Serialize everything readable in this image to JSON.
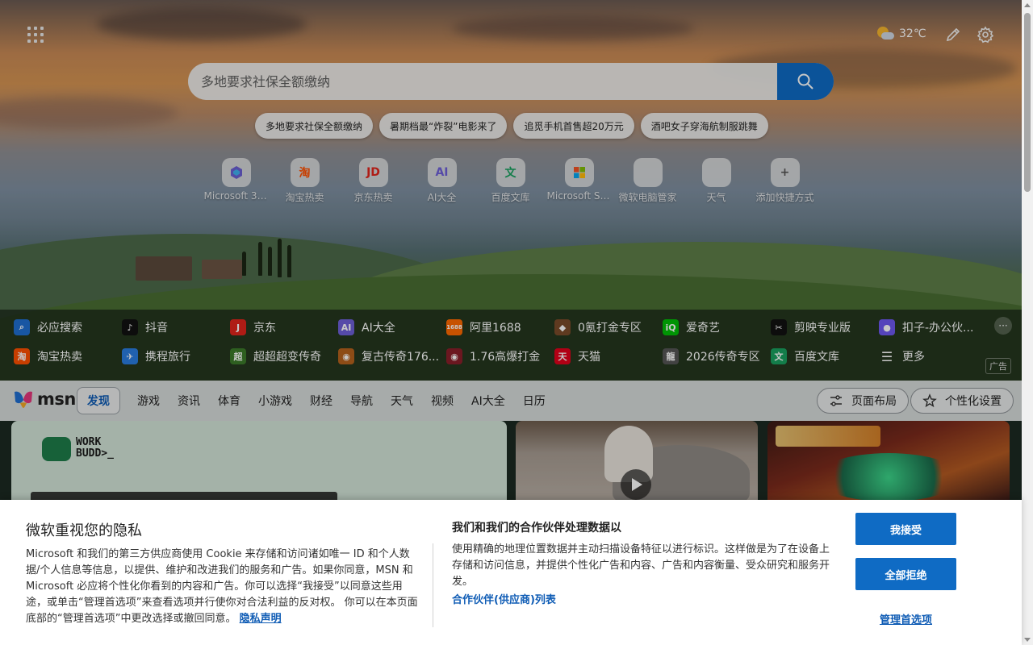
{
  "header": {
    "weather": {
      "temp": "32℃",
      "icon": "partly-cloudy-icon"
    },
    "icons": [
      "apps-grid-icon",
      "pencil-icon",
      "gear-icon"
    ]
  },
  "search": {
    "placeholder": "多地要求社保全额缴纳",
    "button_icon": "search-icon"
  },
  "trending": [
    "多地要求社保全额缴纳",
    "暑期档最“炸裂”电影来了",
    "追觅手机首售超20万元",
    "酒吧女子穿海航制服跳舞"
  ],
  "shortcuts": [
    {
      "label": "Microsoft 365",
      "icon": "m365-icon",
      "glyph": "",
      "color": "#6b5fd3"
    },
    {
      "label": "淘宝热卖",
      "icon": "taobao-icon",
      "glyph": "淘",
      "color": "#ff5000"
    },
    {
      "label": "京东热卖",
      "icon": "jd-icon",
      "glyph": "JD",
      "color": "#e1251b"
    },
    {
      "label": "AI大全",
      "icon": "ai-icon",
      "glyph": "AI",
      "color": "#6d5fd8"
    },
    {
      "label": "百度文库",
      "icon": "baidu-wenku-icon",
      "glyph": "文",
      "color": "#19a15f"
    },
    {
      "label": "Microsoft St...",
      "icon": "microsoft-store-icon",
      "glyph": "",
      "color": "#999"
    },
    {
      "label": "微软电脑管家",
      "icon": "pc-manager-icon",
      "glyph": "",
      "color": "#999"
    },
    {
      "label": "天气",
      "icon": "weather-icon",
      "glyph": "",
      "color": "#999"
    },
    {
      "label": "添加快捷方式",
      "icon": "plus-icon",
      "glyph": "+",
      "color": "#555"
    }
  ],
  "quick_links": [
    {
      "label": "必应搜索",
      "icon": "bing-search-icon",
      "glyph": "⌕",
      "color": "#1f6fd1"
    },
    {
      "label": "抖音",
      "icon": "douyin-icon",
      "glyph": "♪",
      "color": "#111"
    },
    {
      "label": "京东",
      "icon": "jd-icon",
      "glyph": "J",
      "color": "#e1251b"
    },
    {
      "label": "AI大全",
      "icon": "ai-icon",
      "glyph": "AI",
      "color": "#6d5fd8"
    },
    {
      "label": "阿里1688",
      "icon": "ali1688-icon",
      "glyph": "1688",
      "color": "#ff6a00"
    },
    {
      "label": "0氪打金专区",
      "icon": "game-icon",
      "glyph": "◆",
      "color": "#7a4b2a"
    },
    {
      "label": "爱奇艺",
      "icon": "iqiyi-icon",
      "glyph": "iQ",
      "color": "#00be06"
    },
    {
      "label": "剪映专业版",
      "icon": "capcut-icon",
      "glyph": "✂",
      "color": "#111"
    },
    {
      "label": "扣子-办公伙...",
      "icon": "coze-icon",
      "glyph": "●",
      "color": "#6e58f0"
    },
    {
      "label": "淘宝热卖",
      "icon": "taobao-icon",
      "glyph": "淘",
      "color": "#ff5000"
    },
    {
      "label": "携程旅行",
      "icon": "ctrip-icon",
      "glyph": "✈",
      "color": "#2a7de1"
    },
    {
      "label": "超超超变传奇",
      "icon": "game-icon",
      "glyph": "超",
      "color": "#3c7a2a"
    },
    {
      "label": "复古传奇176...",
      "icon": "game-icon",
      "glyph": "◉",
      "color": "#b5621d"
    },
    {
      "label": "1.76高爆打金",
      "icon": "game-icon",
      "glyph": "◉",
      "color": "#8a1e2a"
    },
    {
      "label": "天猫",
      "icon": "tmall-icon",
      "glyph": "天",
      "color": "#e3001b"
    },
    {
      "label": "2026传奇专区",
      "icon": "game-icon",
      "glyph": "龍",
      "color": "#555"
    },
    {
      "label": "百度文库",
      "icon": "baidu-wenku-icon",
      "glyph": "文",
      "color": "#19a15f"
    },
    {
      "label": "更多",
      "icon": "menu-icon",
      "glyph": "☰",
      "color": "transparent"
    }
  ],
  "ql_more": "···",
  "ad_label": "广告",
  "msn": {
    "logo": "msn",
    "tabs": [
      "发现",
      "游戏",
      "资讯",
      "体育",
      "小游戏",
      "财经",
      "导航",
      "天气",
      "视频",
      "AI大全",
      "日历"
    ],
    "layout_button": "页面布局",
    "personalize_button": "个性化设置"
  },
  "cards": {
    "card1_brand": "WORK BUDD>_"
  },
  "privacy": {
    "title": "微软重视您的隐私",
    "body": "Microsoft 和我们的第三方供应商使用 Cookie 来存储和访问诸如唯一 ID 和个人数据/个人信息等信息，以提供、维护和改进我们的服务和广告。如果你同意，MSN 和 Microsoft 必应将个性化你看到的内容和广告。你可以选择“我接受”以同意这些用途，或单击“管理首选项”来查看选项并行使你对合法利益的反对权。 你可以在本页面底部的“管理首选项”中更改选择或撤回同意。",
    "privacy_link": "隐私声明",
    "subtitle": "我们和我们的合作伙伴处理数据以",
    "body2": "使用精确的地理位置数据并主动扫描设备特征以进行标识。这样做是为了在设备上存储和访问信息，并提供个性化广告和内容、广告和内容衡量、受众研究和服务开发。",
    "partners_link": "合作伙伴(供应商)列表",
    "accept": "我接受",
    "reject": "全部拒绝",
    "manage": "管理首选项"
  }
}
